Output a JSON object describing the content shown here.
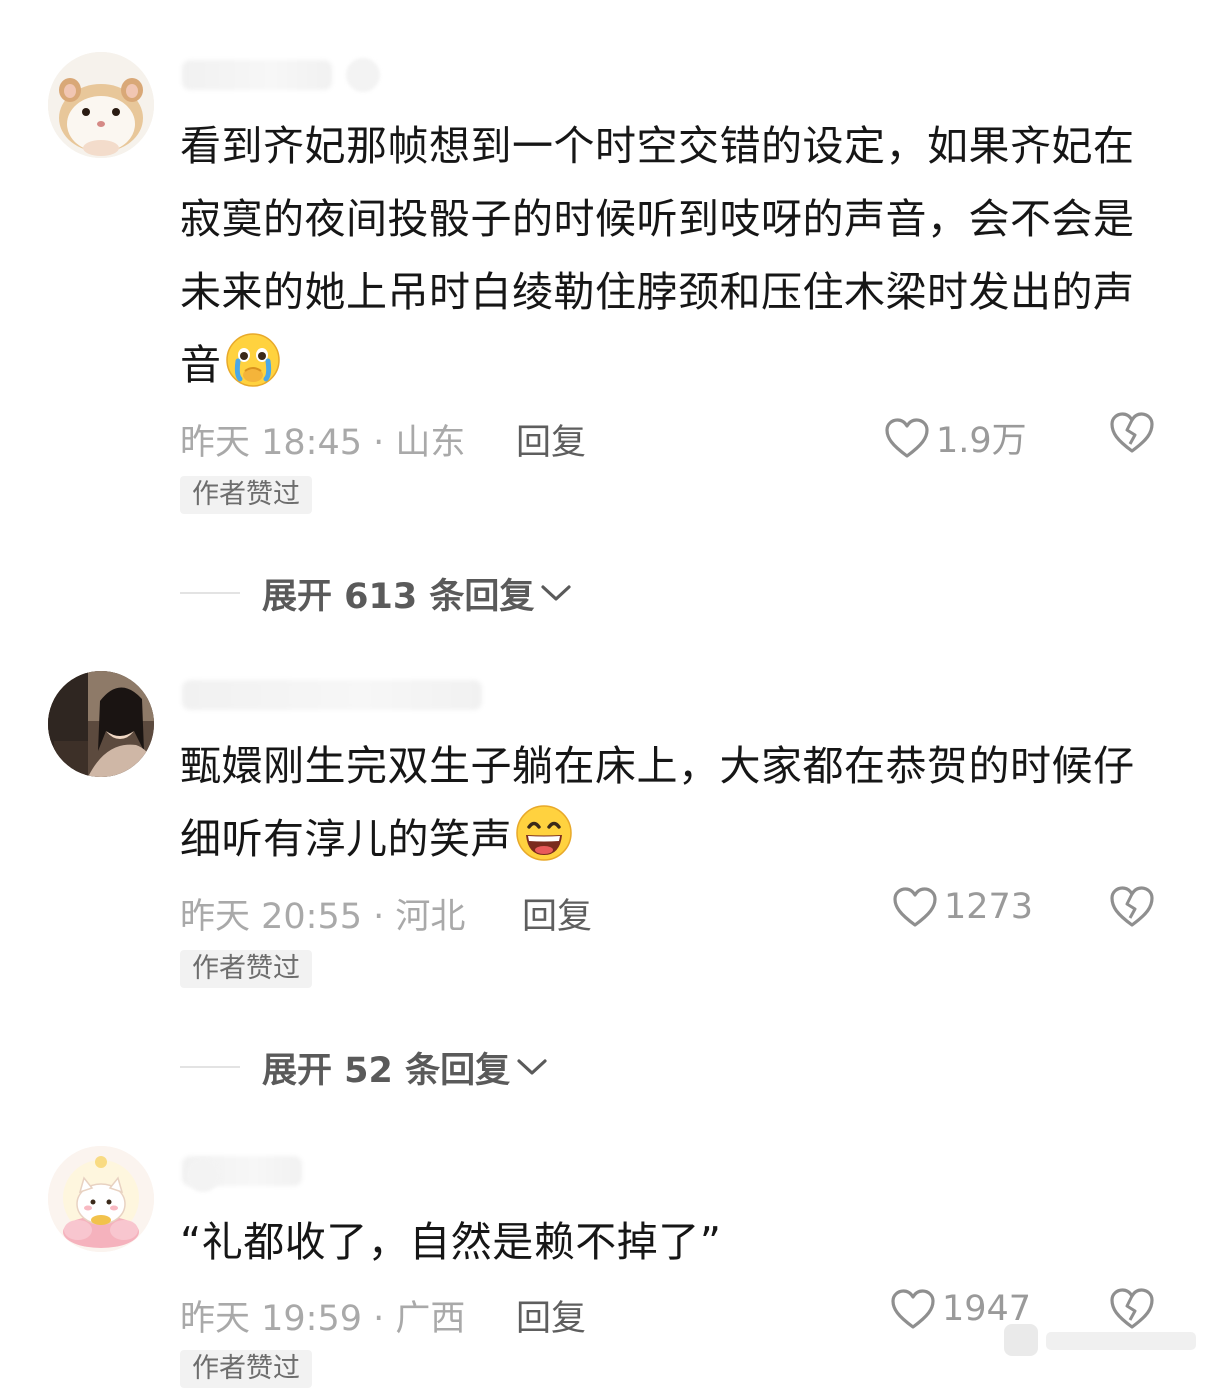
{
  "comments": [
    {
      "text": "看到齐妃那帧想到一个时空交错的设定，如果齐妃在寂寞的夜间投骰子的时候听到吱呀的声音，会不会是未来的她上吊时白绫勒住脖颈和压住木梁时发出的声音",
      "emoji": "crying-face-icon",
      "time": "昨天 18:45 · 山东",
      "reply_label": "回复",
      "likes": "1.9万",
      "badge": "作者赞过",
      "expand_label": "展开 613 条回复"
    },
    {
      "text": "甄嬛刚生完双生子躺在床上，大家都在恭贺的时候仔细听有淳儿的笑声",
      "emoji": "grinning-face-icon",
      "time": "昨天 20:55 · 河北",
      "reply_label": "回复",
      "likes": "1273",
      "badge": "作者赞过",
      "expand_label": "展开 52 条回复"
    },
    {
      "text": "“礼都收了，自然是赖不掉了”",
      "time": "昨天 19:59 · 广西",
      "reply_label": "回复",
      "likes": "1947",
      "badge": "作者赞过"
    }
  ],
  "colors": {
    "text": "#161616",
    "meta": "#a9a9a9",
    "reply": "#5e5e5e",
    "badge_bg": "#f2f2f2"
  }
}
